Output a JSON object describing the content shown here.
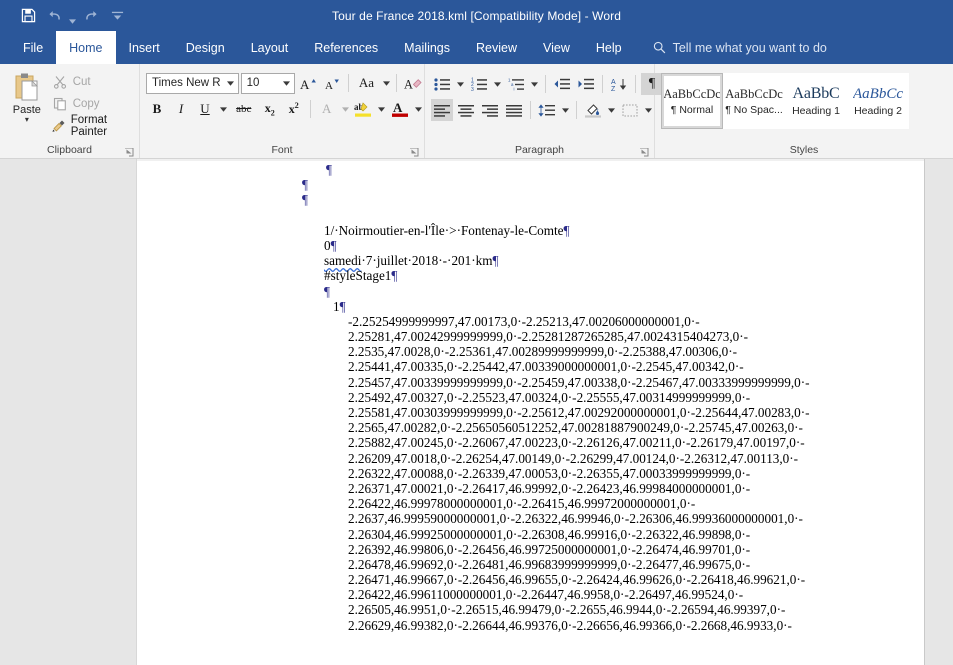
{
  "titlebar": {
    "document_title": "Tour de France 2018.kml [Compatibility Mode]  -  Word",
    "qat": [
      {
        "name": "save",
        "label": "Save"
      },
      {
        "name": "undo",
        "label": "Undo"
      },
      {
        "name": "redo",
        "label": "Redo"
      },
      {
        "name": "customize",
        "label": "Customize Quick Access Toolbar"
      }
    ]
  },
  "tabs": [
    {
      "label": "File",
      "active": false
    },
    {
      "label": "Home",
      "active": true
    },
    {
      "label": "Insert",
      "active": false
    },
    {
      "label": "Design",
      "active": false
    },
    {
      "label": "Layout",
      "active": false
    },
    {
      "label": "References",
      "active": false
    },
    {
      "label": "Mailings",
      "active": false
    },
    {
      "label": "Review",
      "active": false
    },
    {
      "label": "View",
      "active": false
    },
    {
      "label": "Help",
      "active": false
    }
  ],
  "tell_me": "Tell me what you want to do",
  "ribbon": {
    "clipboard": {
      "group_label": "Clipboard",
      "paste_label": "Paste",
      "cut_label": "Cut",
      "copy_label": "Copy",
      "format_painter_label": "Format Painter"
    },
    "font": {
      "group_label": "Font",
      "font_name": "Times New R",
      "font_size": "10",
      "bold_label": "B",
      "italic_label": "I",
      "underline_label": "U",
      "strikethrough_label": "abc",
      "subscript_label": "x",
      "superscript_label": "x",
      "change_case_label": "Aa",
      "text_effects_label": "A",
      "text_highlight_label": "ab",
      "font_color_label": "A",
      "grow_font_label": "A",
      "shrink_font_label": "A"
    },
    "paragraph": {
      "group_label": "Paragraph"
    },
    "styles": {
      "group_label": "Styles",
      "items": [
        {
          "preview": "AaBbCcDc",
          "name": "¶ Normal",
          "selected": true
        },
        {
          "preview": "AaBbCcDc",
          "name": "¶ No Spac...",
          "selected": false
        },
        {
          "preview": "AaBbC",
          "name": "Heading 1",
          "selected": false
        },
        {
          "preview": "AaBbCc",
          "name": "Heading 2",
          "selected": false
        }
      ]
    }
  },
  "document": {
    "pilcrow": "¶",
    "header_lines": [
      "1/·Noirmoutier-en-l'Île·>·Fontenay-le-Comte",
      "0",
      "samedi·7·juillet·2018·-·201·km",
      "#styleStage1"
    ],
    "spell_error_word": "samedi",
    "index_line": "1",
    "coordinate_lines": [
      "-2.25254999999997,47.00173,0·-2.25213,47.00206000000001,0·-",
      "2.25281,47.00242999999999,0·-2.25281287265285,47.0024315404273,0·-",
      "2.2535,47.0028,0·-2.25361,47.00289999999999,0·-2.25388,47.00306,0·-",
      "2.25441,47.00335,0·-2.25442,47.00339000000001,0·-2.2545,47.00342,0·-",
      "2.25457,47.00339999999999,0·-2.25459,47.00338,0·-2.25467,47.00333999999999,0·-",
      "2.25492,47.00327,0·-2.25523,47.00324,0·-2.25555,47.00314999999999,0·-",
      "2.25581,47.00303999999999,0·-2.25612,47.00292000000001,0·-2.25644,47.00283,0·-",
      "2.2565,47.00282,0·-2.25650560512252,47.00281887900249,0·-2.25745,47.00263,0·-",
      "2.25882,47.00245,0·-2.26067,47.00223,0·-2.26126,47.00211,0·-2.26179,47.00197,0·-",
      "2.26209,47.0018,0·-2.26254,47.00149,0·-2.26299,47.00124,0·-2.26312,47.00113,0·-",
      "2.26322,47.00088,0·-2.26339,47.00053,0·-2.26355,47.00033999999999,0·-",
      "2.26371,47.00021,0·-2.26417,46.99992,0·-2.26423,46.99984000000001,0·-",
      "2.26422,46.99978000000001,0·-2.26415,46.99972000000001,0·-",
      "2.2637,46.99959000000001,0·-2.26322,46.99946,0·-2.26306,46.99936000000001,0·-",
      "2.26304,46.99925000000001,0·-2.26308,46.99916,0·-2.26322,46.99898,0·-",
      "2.26392,46.99806,0·-2.26456,46.99725000000001,0·-2.26474,46.99701,0·-",
      "2.26478,46.99692,0·-2.26481,46.99683999999999,0·-2.26477,46.99675,0·-",
      "2.26471,46.99667,0·-2.26456,46.99655,0·-2.26424,46.99626,0·-2.26418,46.99621,0·-",
      "2.26422,46.99611000000001,0·-2.26447,46.9958,0·-2.26497,46.99524,0·-",
      "2.26505,46.9951,0·-2.26515,46.99479,0·-2.2655,46.9944,0·-2.26594,46.99397,0·-",
      "2.26629,46.99382,0·-2.26644,46.99376,0·-2.26656,46.99366,0·-2.2668,46.9933,0·-"
    ]
  },
  "colors": {
    "title_bar": "#2b579a",
    "ribbon_bg": "#f3f3f3",
    "workspace_bg": "#e6e6e6",
    "page_bg": "#ffffff",
    "accent_text": "#ffffff",
    "pilcrow": "#2b2b8a"
  }
}
